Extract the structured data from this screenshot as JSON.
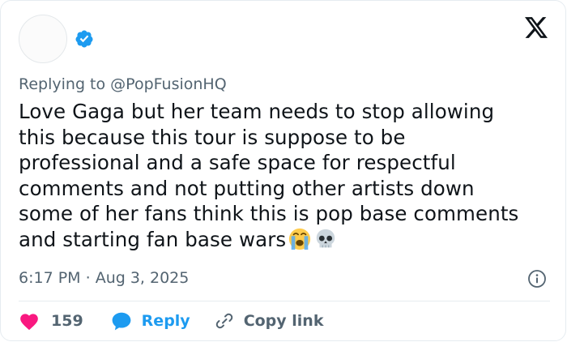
{
  "tweet": {
    "replying_prefix": "Replying to",
    "replying_to": "@PopFusionHQ",
    "text_lines": [
      "Love Gaga but her team needs to stop allowing",
      "this because this tour is suppose to be",
      "professional and a safe space for respectful",
      "comments and not putting other artists down",
      "some of her fans think this is pop base comments",
      "and starting fan base wars"
    ],
    "emojis": [
      "loudly-crying-face",
      "skull"
    ],
    "time": "6:17 PM",
    "separator": "·",
    "date": "Aug 3, 2025"
  },
  "actions": {
    "like_count": "159",
    "reply_label": "Reply",
    "copy_link_label": "Copy link"
  },
  "icons": {
    "verified": "verified-badge-icon",
    "brand": "x-logo-icon",
    "info": "info-icon",
    "like": "heart-icon",
    "reply": "speech-bubble-icon",
    "copy": "link-icon"
  },
  "colors": {
    "accent": "#1d9bf0",
    "like": "#f91880",
    "text": "#0f1419",
    "muted": "#536471",
    "border": "#e6ecf0"
  }
}
